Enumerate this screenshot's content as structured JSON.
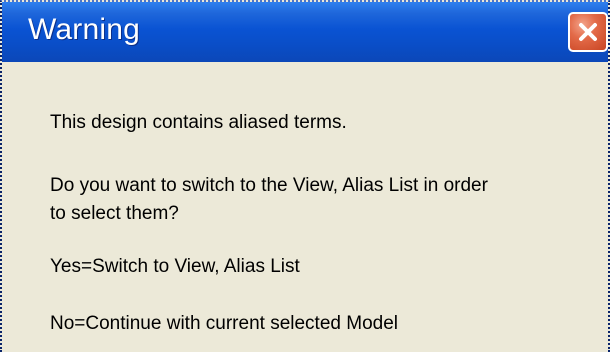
{
  "dialog": {
    "title": "Warning",
    "close_icon": "close-icon",
    "message_lines": [
      "This design contains aliased terms.",
      "Do you want to switch to the View, Alias List in order",
      "to select them?",
      "Yes=Switch to View, Alias List",
      "No=Continue with current selected Model"
    ]
  },
  "colors": {
    "title_bar": "#0a53d3",
    "dialog_background": "#ece9d8",
    "close_button": "#e36a48"
  }
}
